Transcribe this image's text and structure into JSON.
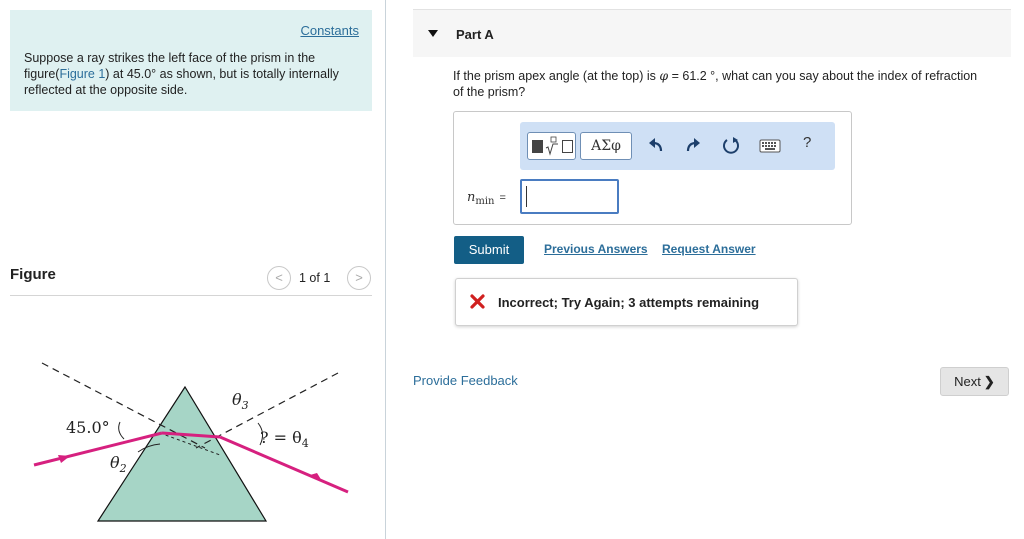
{
  "problem": {
    "constants_label": "Constants",
    "text_before": "Suppose a ray strikes the left face of the prism in the figure(",
    "figure_link": "Figure 1",
    "text_after": ") at 45.0° as shown, but is totally internally reflected at the opposite side."
  },
  "figure": {
    "title": "Figure",
    "page_count": "1 of 1",
    "prev_glyph": "<",
    "next_glyph": ">",
    "angle_incident": "45.0°",
    "theta2": "θ2",
    "theta3": "θ3",
    "theta4": "? = θ4",
    "colors": {
      "prism": "#a6d5c6",
      "ray": "#d6207f"
    }
  },
  "part": {
    "title": "Part A",
    "question_before": "If the prism apex angle (at the top) is ",
    "phi_symbol": "φ",
    "question_after": " = 61.2 °, what can you say about the index of refraction of the prism?"
  },
  "toolbar": {
    "greek_label": "ΑΣφ",
    "help_label": "?",
    "icons": [
      "templates-icon",
      "greek-icon",
      "undo-icon",
      "redo-icon",
      "reset-icon",
      "keyboard-icon",
      "help-icon"
    ]
  },
  "answer": {
    "variable": "n",
    "subscript": "min",
    "equals": "=",
    "value": ""
  },
  "actions": {
    "submit_label": "Submit",
    "previous_answers_label": "Previous Answers",
    "request_answer_label": "Request Answer"
  },
  "feedback": {
    "message": "Incorrect; Try Again; 3 attempts remaining",
    "status_color": "#d0201f"
  },
  "footer": {
    "provide_feedback_label": "Provide Feedback",
    "next_label": "Next"
  }
}
